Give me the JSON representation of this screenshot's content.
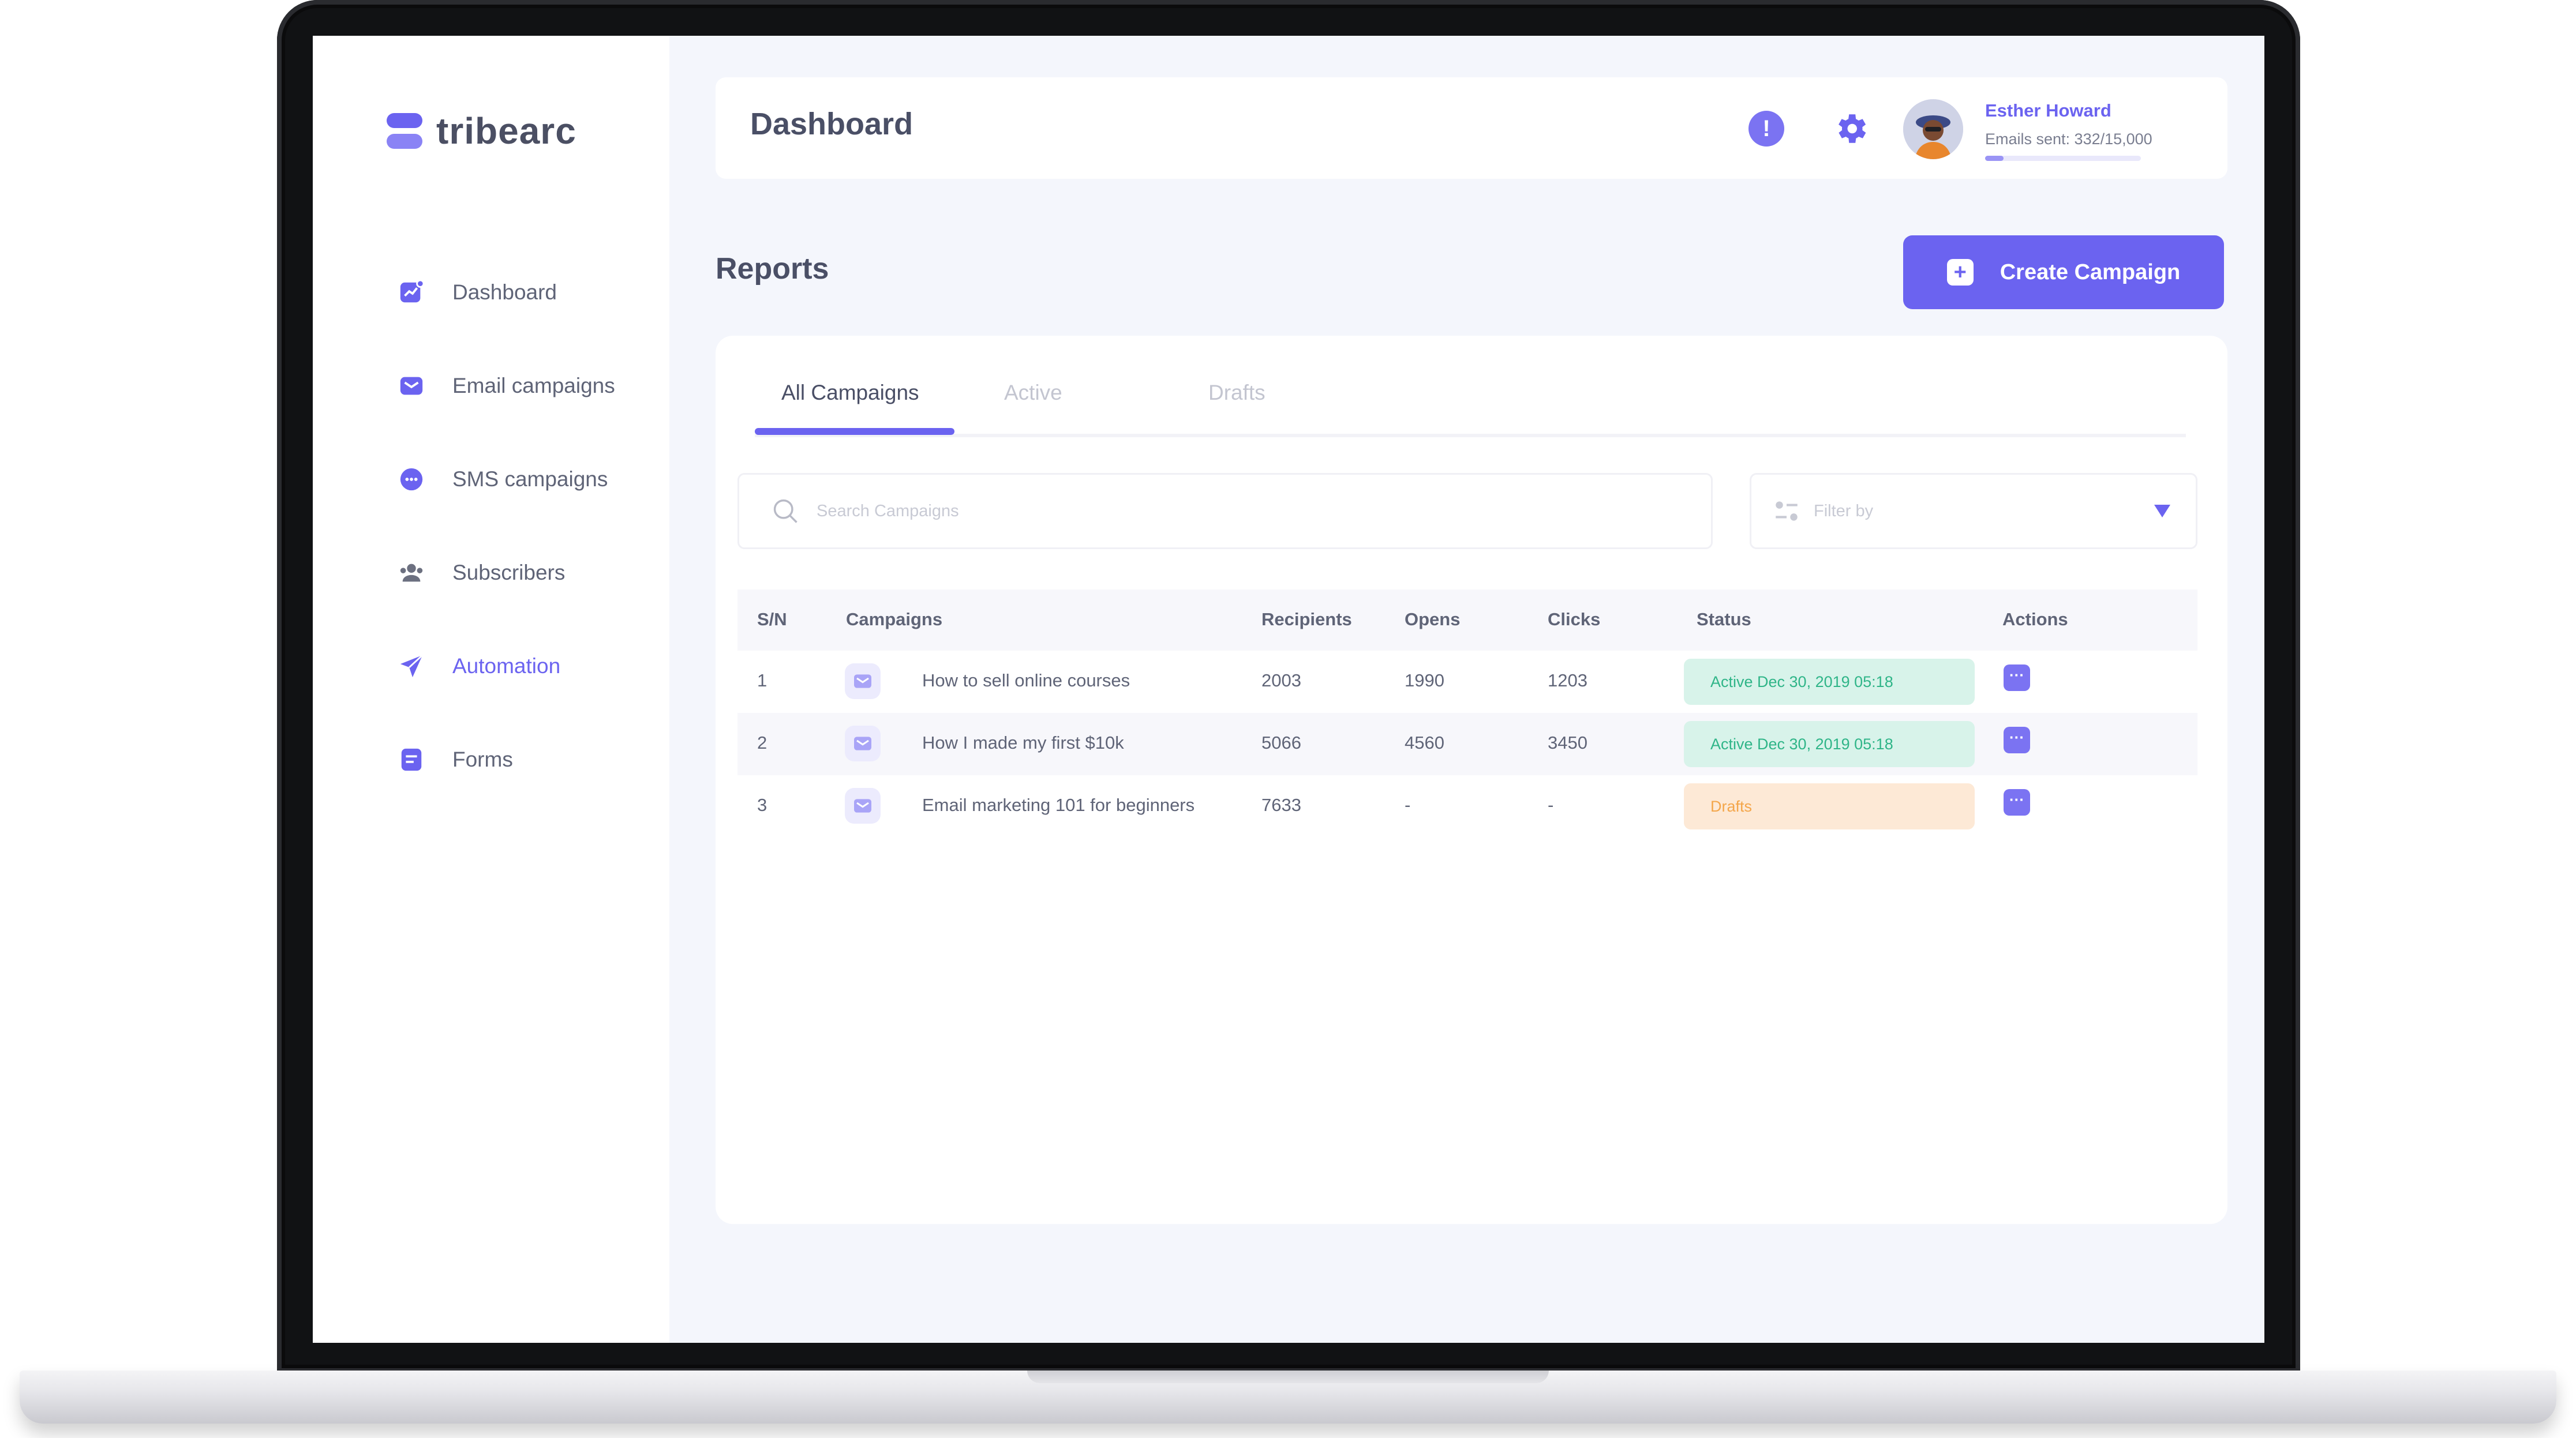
{
  "brand": {
    "name": "tribearc"
  },
  "sidebar": {
    "items": [
      {
        "label": "Dashboard",
        "icon": "chart-icon",
        "active": false
      },
      {
        "label": "Email campaigns",
        "icon": "mail-icon",
        "active": false
      },
      {
        "label": "SMS campaigns",
        "icon": "chat-icon",
        "active": false
      },
      {
        "label": "Subscribers",
        "icon": "users-icon",
        "active": false
      },
      {
        "label": "Automation",
        "icon": "send-icon",
        "active": true
      },
      {
        "label": "Forms",
        "icon": "form-icon",
        "active": false
      }
    ]
  },
  "header": {
    "title": "Dashboard",
    "user": {
      "name": "Esther Howard",
      "emails_sent": "Emails sent: 332/15,000",
      "usage_fraction": 0.12
    }
  },
  "reports": {
    "title": "Reports",
    "create_button": "Create Campaign",
    "tabs": [
      "All Campaigns",
      "Active",
      "Drafts"
    ],
    "search_placeholder": "Search Campaigns",
    "filter_placeholder": "Filter by",
    "columns": [
      "S/N",
      "Campaigns",
      "Recipients",
      "Opens",
      "Clicks",
      "Status",
      "Actions"
    ],
    "rows": [
      {
        "sn": "1",
        "campaign": "How to sell online courses",
        "recipients": "2003",
        "opens": "1990",
        "clicks": "1203",
        "status": "Active Dec 30, 2019 05:18",
        "status_type": "active"
      },
      {
        "sn": "2",
        "campaign": "How I made my first $10k",
        "recipients": "5066",
        "opens": "4560",
        "clicks": "3450",
        "status": "Active Dec 30, 2019 05:18",
        "status_type": "active"
      },
      {
        "sn": "3",
        "campaign": "Email marketing 101 for beginners",
        "recipients": "7633",
        "opens": "-",
        "clicks": "-",
        "status": "Drafts",
        "status_type": "draft"
      }
    ],
    "action_glyph": "···"
  },
  "colors": {
    "accent": "#6b63f0",
    "active_bg": "#d8f3ea",
    "active_text": "#2fb588",
    "draft_bg": "#fde9d6",
    "draft_text": "#f4a64a"
  }
}
